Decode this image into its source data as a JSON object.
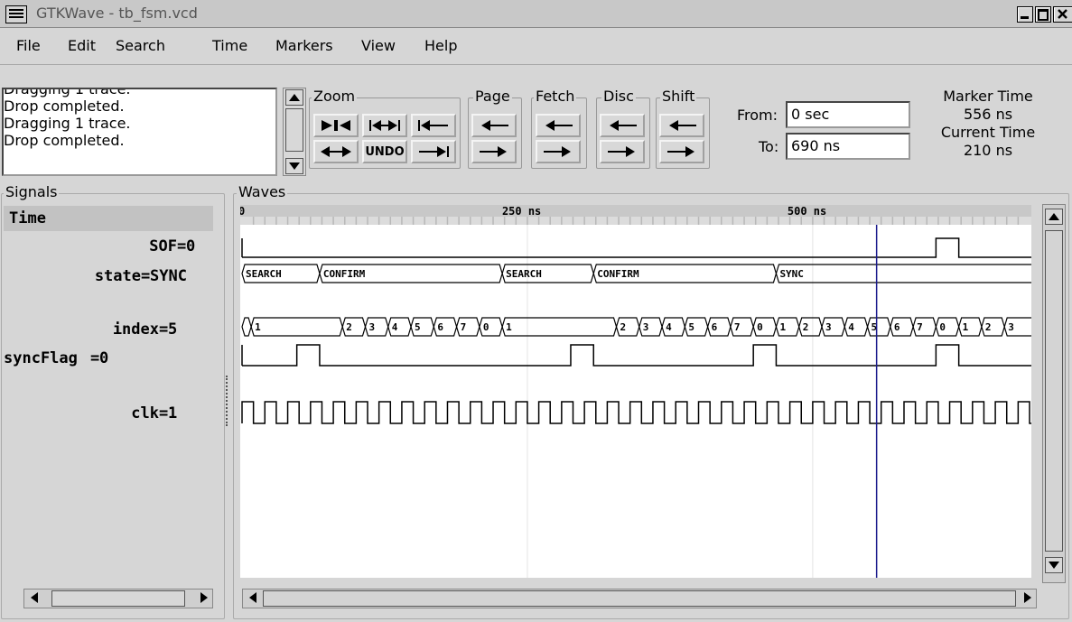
{
  "window": {
    "title": "GTKWave - tb_fsm.vcd",
    "buttons": [
      "minimize-icon",
      "maximize-icon",
      "close-icon"
    ]
  },
  "menu": [
    "File",
    "Edit",
    "Search",
    "Time",
    "Markers",
    "View",
    "Help"
  ],
  "status": {
    "lines": [
      "Drop completed.",
      "Dragging 1 trace.",
      "Drop completed."
    ]
  },
  "toolbar": {
    "zoom_label": "Zoom",
    "undo_label": "UNDO",
    "page_label": "Page",
    "fetch_label": "Fetch",
    "disc_label": "Disc",
    "shift_label": "Shift",
    "from_label": "From:",
    "from_value": "0 sec",
    "to_label": "To:",
    "to_value": "690 ns"
  },
  "times": {
    "marker_label": "Marker Time",
    "marker_value": "556 ns",
    "current_label": "Current Time",
    "current_value": "210 ns"
  },
  "panes": {
    "signals_label": "Signals",
    "waves_label": "Waves"
  },
  "signals": [
    {
      "label": "Time",
      "value": ""
    },
    {
      "label": "SOF",
      "value": "0"
    },
    {
      "label": "state",
      "value": "SYNC"
    },
    {
      "label": "index",
      "value": "5"
    },
    {
      "label": "syncFlag",
      "value": "0"
    },
    {
      "label": "clk",
      "value": "1"
    }
  ],
  "timeline": {
    "ticks": [
      "0",
      "250 ns",
      "500 ns"
    ],
    "range_ns": [
      0,
      690
    ],
    "marker_ns": 556
  },
  "waves": {
    "state": [
      {
        "t": 0,
        "label": "SEARCH"
      },
      {
        "t": 68,
        "label": "CONFIRM"
      },
      {
        "t": 228,
        "label": "SEARCH"
      },
      {
        "t": 308,
        "label": "CONFIRM"
      },
      {
        "t": 468,
        "label": "SYNC"
      }
    ],
    "index": [
      {
        "t": 0,
        "label": ""
      },
      {
        "t": 8,
        "label": "1"
      },
      {
        "t": 88,
        "label": "2"
      },
      {
        "t": 108,
        "label": "3"
      },
      {
        "t": 128,
        "label": "4"
      },
      {
        "t": 148,
        "label": "5"
      },
      {
        "t": 168,
        "label": "6"
      },
      {
        "t": 188,
        "label": "7"
      },
      {
        "t": 208,
        "label": "0"
      },
      {
        "t": 228,
        "label": "1"
      },
      {
        "t": 328,
        "label": "2"
      },
      {
        "t": 348,
        "label": "3"
      },
      {
        "t": 368,
        "label": "4"
      },
      {
        "t": 388,
        "label": "5"
      },
      {
        "t": 408,
        "label": "6"
      },
      {
        "t": 428,
        "label": "7"
      },
      {
        "t": 448,
        "label": "0"
      },
      {
        "t": 468,
        "label": "1"
      },
      {
        "t": 488,
        "label": "2"
      },
      {
        "t": 508,
        "label": "3"
      },
      {
        "t": 528,
        "label": "4"
      },
      {
        "t": 548,
        "label": "5"
      },
      {
        "t": 568,
        "label": "6"
      },
      {
        "t": 588,
        "label": "7"
      },
      {
        "t": 608,
        "label": "0"
      },
      {
        "t": 628,
        "label": "1"
      },
      {
        "t": 648,
        "label": "2"
      },
      {
        "t": 668,
        "label": "3"
      }
    ],
    "sof_pulses": [
      [
        608,
        628
      ]
    ],
    "syncflag_pulses": [
      [
        48,
        68
      ],
      [
        288,
        308
      ],
      [
        448,
        468
      ],
      [
        608,
        628
      ]
    ],
    "clk_period_ns": 20
  }
}
